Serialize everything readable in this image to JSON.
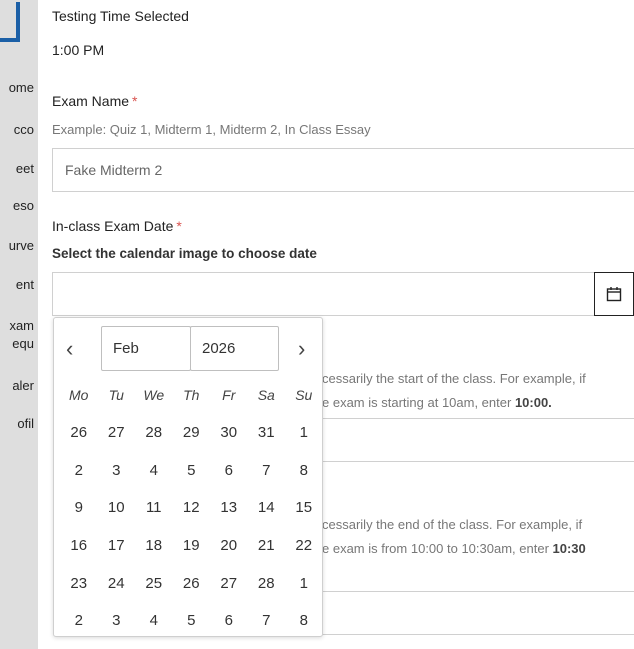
{
  "sidebar": {
    "items": [
      "ome",
      "cco",
      "eet",
      "eso",
      "urve",
      "ent",
      "xam",
      "equ",
      "aler",
      "ofil"
    ]
  },
  "testing_time": {
    "label": "Testing Time Selected",
    "value": "1:00 PM"
  },
  "exam_name": {
    "label": "Exam Name",
    "required_mark": "*",
    "help": "Example: Quiz 1, Midterm 1, Midterm 2, In Class Essay",
    "value": "Fake Midterm 2"
  },
  "exam_date": {
    "label": "In-class Exam Date",
    "required_mark": "*",
    "note": "Select the calendar image to choose date",
    "value": "",
    "calendar_icon": "calendar-icon"
  },
  "start_time": {
    "help_line1": "cessarily the start of the class. For example, if",
    "help_line2_prefix": "e exam is starting at 10am, enter ",
    "help_line2_bold": "10:00."
  },
  "end_time": {
    "help_line1": "cessarily the end of the class. For example, if",
    "help_line2_prefix": "e exam is from 10:00 to 10:30am, enter ",
    "help_line2_bold": "10:30"
  },
  "datepicker": {
    "prev_icon": "chevron-left-icon",
    "next_icon": "chevron-right-icon",
    "prev_glyph": "‹",
    "next_glyph": "›",
    "month": "Feb",
    "year": "2026",
    "weekdays": [
      "Mo",
      "Tu",
      "We",
      "Th",
      "Fr",
      "Sa",
      "Su"
    ],
    "weeks": [
      [
        "26",
        "27",
        "28",
        "29",
        "30",
        "31",
        "1"
      ],
      [
        "2",
        "3",
        "4",
        "5",
        "6",
        "7",
        "8"
      ],
      [
        "9",
        "10",
        "11",
        "12",
        "13",
        "14",
        "15"
      ],
      [
        "16",
        "17",
        "18",
        "19",
        "20",
        "21",
        "22"
      ],
      [
        "23",
        "24",
        "25",
        "26",
        "27",
        "28",
        "1"
      ],
      [
        "2",
        "3",
        "4",
        "5",
        "6",
        "7",
        "8"
      ]
    ]
  }
}
